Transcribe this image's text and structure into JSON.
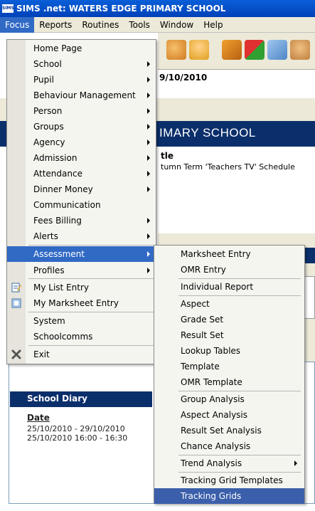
{
  "window": {
    "app_icon": "SIMS",
    "title": "SIMS .net: WATERS EDGE PRIMARY SCHOOL"
  },
  "menubar": [
    "Focus",
    "Reports",
    "Routines",
    "Tools",
    "Window",
    "Help"
  ],
  "background": {
    "date_fragment": "9/10/2010",
    "banner_fragment": "IMARY SCHOOL",
    "schedule_heading": "tle",
    "schedule_text": "tumn Term 'Teachers TV' Schedule"
  },
  "focus_menu": [
    {
      "label": "Home Page",
      "sub": false
    },
    {
      "label": "School",
      "sub": true
    },
    {
      "label": "Pupil",
      "sub": true
    },
    {
      "label": "Behaviour Management",
      "sub": true
    },
    {
      "label": "Person",
      "sub": true
    },
    {
      "label": "Groups",
      "sub": true
    },
    {
      "label": "Agency",
      "sub": true
    },
    {
      "label": "Admission",
      "sub": true
    },
    {
      "label": "Attendance",
      "sub": true
    },
    {
      "label": "Dinner Money",
      "sub": true
    },
    {
      "label": "Communication",
      "sub": false
    },
    {
      "label": "Fees Billing",
      "sub": true
    },
    {
      "label": "Alerts",
      "sub": true
    },
    {
      "label": "Assessment",
      "sub": true
    },
    {
      "label": "Profiles",
      "sub": true
    },
    {
      "label": "My List Entry",
      "sub": false
    },
    {
      "label": "My Marksheet Entry",
      "sub": false
    },
    {
      "label": "System",
      "sub": false
    },
    {
      "label": "Schoolcomms",
      "sub": false
    },
    {
      "label": "Exit",
      "sub": false
    }
  ],
  "assessment_submenu": [
    "Marksheet Entry",
    "OMR Entry",
    "Individual Report",
    "Aspect",
    "Grade Set",
    "Result Set",
    "Lookup Tables",
    "Template",
    "OMR Template",
    "Group Analysis",
    "Aspect Analysis",
    "Result Set Analysis",
    "Chance Analysis",
    "Trend Analysis",
    "Tracking Grid Templates",
    "Tracking Grids"
  ],
  "diary": {
    "title": "School Diary",
    "date_label": "Date",
    "rows": [
      "25/10/2010 - 29/10/2010",
      "25/10/2010 16:00 - 16:30"
    ]
  },
  "colors": {
    "selection": "#316ac5",
    "banner": "#0b2f6b",
    "titlebar": "#0a5fd8"
  }
}
